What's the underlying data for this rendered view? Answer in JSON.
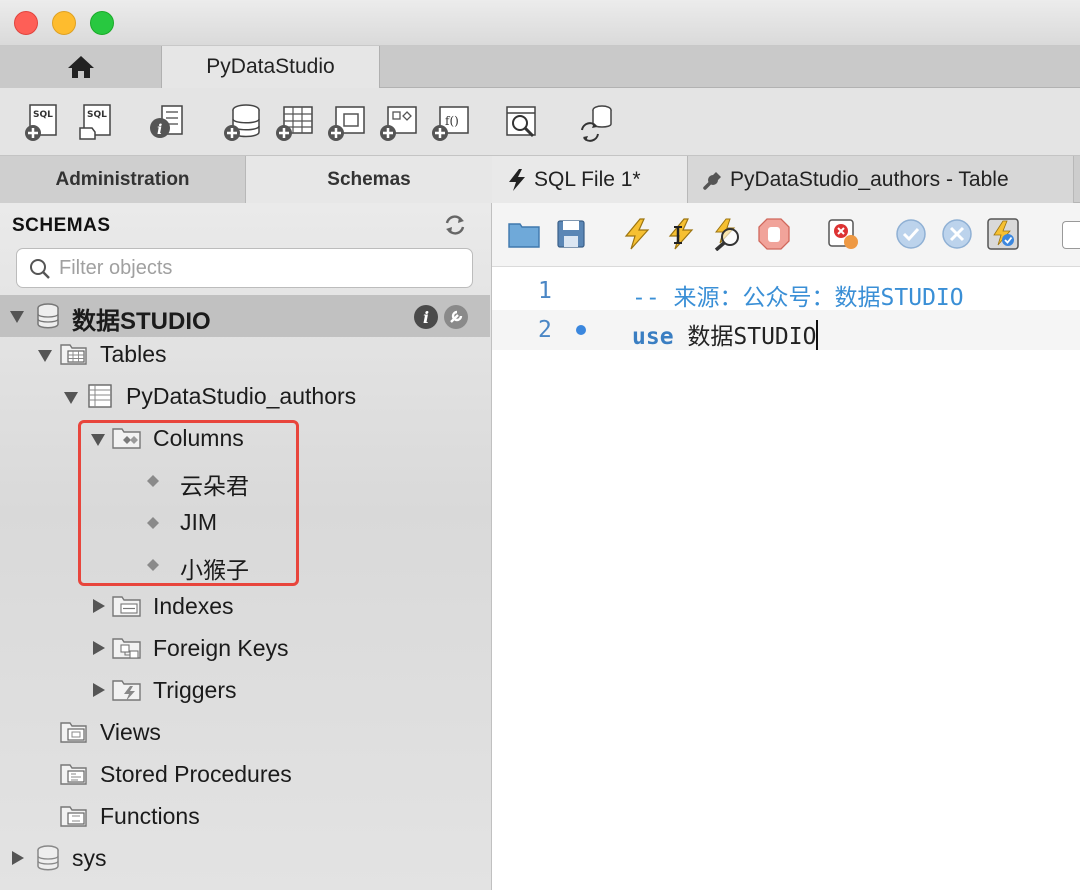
{
  "window": {
    "connection_tab": "PyDataStudio"
  },
  "side_tabs": {
    "administration": "Administration",
    "schemas": "Schemas"
  },
  "sidebar": {
    "header": "SCHEMAS",
    "filter_placeholder": "Filter objects",
    "schema_name": "数据STUDIO",
    "tables_label": "Tables",
    "table_name": "PyDataStudio_authors",
    "columns_label": "Columns",
    "columns": [
      "云朵君",
      "JIM",
      "小猴子"
    ],
    "indexes_label": "Indexes",
    "foreign_keys_label": "Foreign Keys",
    "triggers_label": "Triggers",
    "views_label": "Views",
    "stored_procedures_label": "Stored Procedures",
    "functions_label": "Functions",
    "other_schema": "sys"
  },
  "editor_tabs": {
    "sql_file": "SQL File 1*",
    "table_tab": "PyDataStudio_authors - Table"
  },
  "editor": {
    "lines": [
      {
        "number": "1",
        "comment": "-- 来源：公众号：数据STUDIO"
      },
      {
        "number": "2",
        "keyword": "use",
        "text": " 数据STUDIO"
      }
    ]
  },
  "colors": {
    "highlight_box": "#e8453c",
    "line_number": "#4a86c5",
    "comment": "#3a8fd6"
  }
}
